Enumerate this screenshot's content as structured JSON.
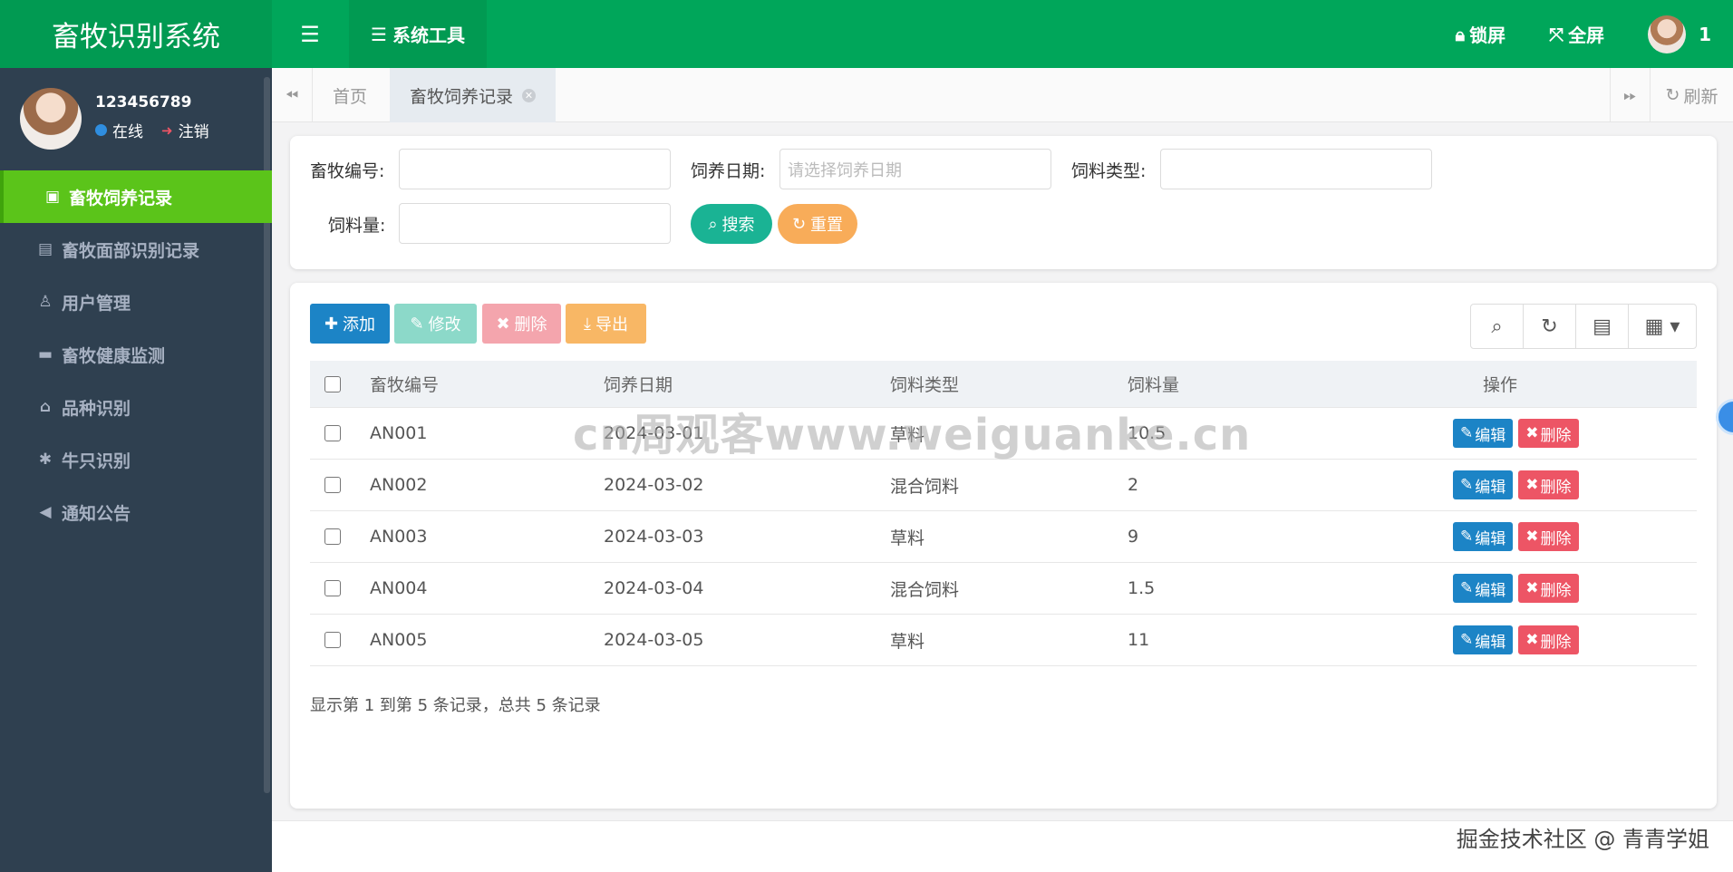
{
  "header": {
    "brand": "畜牧识别系统",
    "menu_toggle_icon": "hamburger-icon",
    "sys_tools": "系统工具",
    "lock": "锁屏",
    "fullscreen": "全屏",
    "user_short": "1"
  },
  "sidebar": {
    "username": "123456789",
    "status": "在线",
    "logout": "注销",
    "items": [
      {
        "label": "畜牧饲养记录",
        "icon": "box-icon"
      },
      {
        "label": "畜牧面部识别记录",
        "icon": "id-card-icon"
      },
      {
        "label": "用户管理",
        "icon": "user-icon"
      },
      {
        "label": "畜牧健康监测",
        "icon": "briefcase-icon"
      },
      {
        "label": "品种识别",
        "icon": "bank-icon"
      },
      {
        "label": "牛只识别",
        "icon": "asterisk-icon"
      },
      {
        "label": "通知公告",
        "icon": "bullhorn-icon"
      }
    ]
  },
  "tabs": {
    "home": "首页",
    "active": "畜牧饲养记录",
    "refresh": "刷新"
  },
  "search": {
    "labels": {
      "livestock_id": "畜牧编号:",
      "feed_date": "饲养日期:",
      "feed_type": "饲料类型:",
      "feed_amount": "饲料量:"
    },
    "date_placeholder": "请选择饲养日期",
    "search_btn": "搜索",
    "reset_btn": "重置"
  },
  "toolbar": {
    "add": "添加",
    "edit": "修改",
    "delete": "删除",
    "export": "导出"
  },
  "table": {
    "headers": [
      "畜牧编号",
      "饲养日期",
      "饲料类型",
      "饲料量",
      "操作"
    ],
    "rows": [
      {
        "id": "AN001",
        "date": "2024-03-01",
        "type": "草料",
        "amount": "10.5"
      },
      {
        "id": "AN002",
        "date": "2024-03-02",
        "type": "混合饲料",
        "amount": "2"
      },
      {
        "id": "AN003",
        "date": "2024-03-03",
        "type": "草料",
        "amount": "9"
      },
      {
        "id": "AN004",
        "date": "2024-03-04",
        "type": "混合饲料",
        "amount": "1.5"
      },
      {
        "id": "AN005",
        "date": "2024-03-05",
        "type": "草料",
        "amount": "11"
      }
    ],
    "row_edit": "编辑",
    "row_delete": "删除",
    "pager": "显示第 1 到第 5 条记录，总共 5 条记录"
  },
  "watermark": "cn周观客www.weiguanke.cn",
  "footer": "掘金技术社区 @ 青青学姐",
  "colors": {
    "header": "#00a65a",
    "sidebar": "#2f4050",
    "active_menu": "#5bc41a",
    "primary": "#1c84c6",
    "danger": "#ed5565",
    "success": "#1ab394",
    "warning": "#f8ac59"
  }
}
